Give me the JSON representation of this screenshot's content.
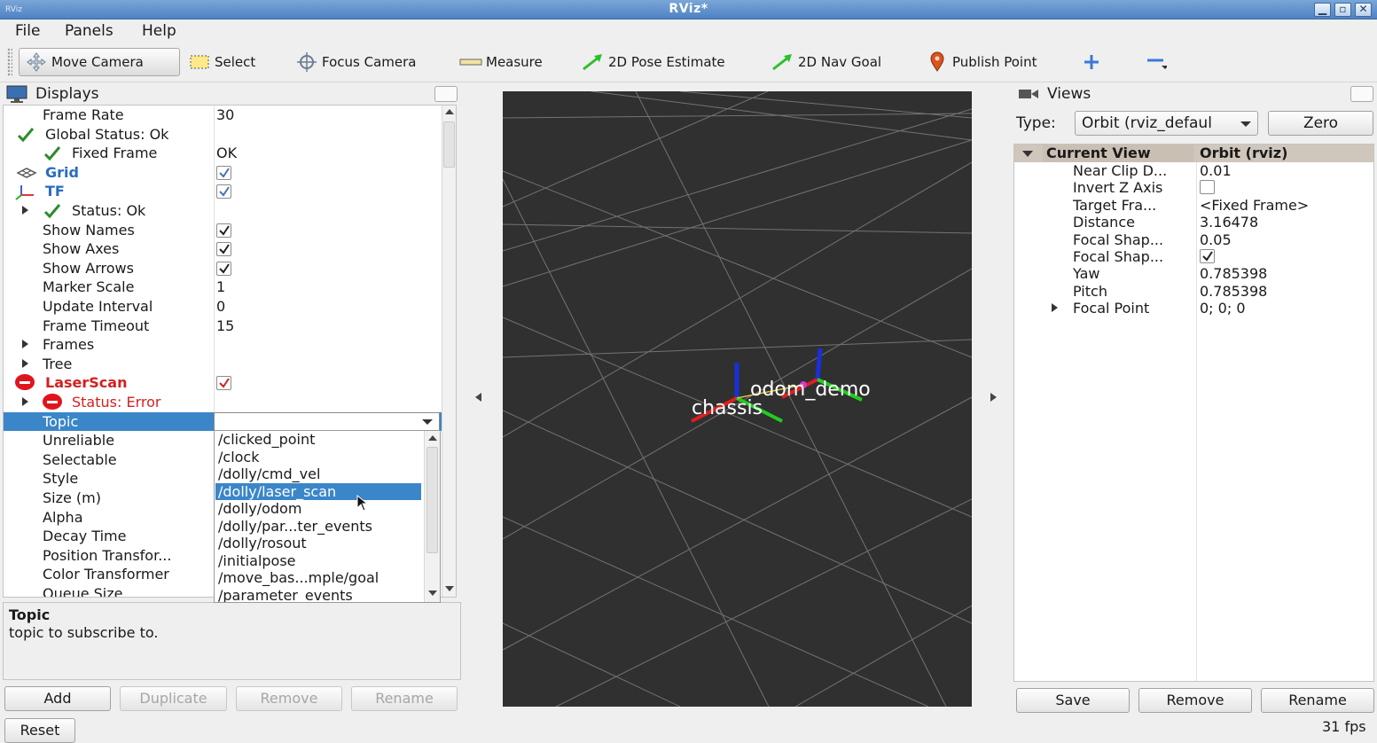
{
  "window": {
    "title": "RViz*",
    "app_icon": "RViz"
  },
  "menu": [
    "File",
    "Panels",
    "Help"
  ],
  "toolbar": [
    {
      "label": "Move Camera",
      "icon": "move-camera-icon",
      "active": true
    },
    {
      "label": "Select",
      "icon": "select-icon"
    },
    {
      "label": "Focus Camera",
      "icon": "focus-camera-icon"
    },
    {
      "label": "Measure",
      "icon": "measure-icon"
    },
    {
      "label": "2D Pose Estimate",
      "icon": "pose-estimate-arrow-icon"
    },
    {
      "label": "2D Nav Goal",
      "icon": "nav-goal-arrow-icon"
    },
    {
      "label": "Publish Point",
      "icon": "publish-point-pin-icon"
    }
  ],
  "displays": {
    "title": "Displays",
    "rows": [
      {
        "name": "Frame Rate",
        "value": "30"
      },
      {
        "name": "Global Status: Ok"
      },
      {
        "name": "Fixed Frame",
        "value": "OK"
      },
      {
        "name": "Grid"
      },
      {
        "name": "TF"
      },
      {
        "name": "Status: Ok"
      },
      {
        "name": "Show Names"
      },
      {
        "name": "Show Axes"
      },
      {
        "name": "Show Arrows"
      },
      {
        "name": "Marker Scale",
        "value": "1"
      },
      {
        "name": "Update Interval",
        "value": "0"
      },
      {
        "name": "Frame Timeout",
        "value": "15"
      },
      {
        "name": "Frames"
      },
      {
        "name": "Tree"
      },
      {
        "name": "LaserScan"
      },
      {
        "name": "Status: Error"
      },
      {
        "name": "Topic",
        "value": ""
      },
      {
        "name": "Unreliable"
      },
      {
        "name": "Selectable"
      },
      {
        "name": "Style"
      },
      {
        "name": "Size (m)"
      },
      {
        "name": "Alpha"
      },
      {
        "name": "Decay Time"
      },
      {
        "name": "Position Transfor..."
      },
      {
        "name": "Color Transformer"
      },
      {
        "name": "Queue Size"
      }
    ],
    "topic_options": [
      "/clicked_point",
      "/clock",
      "/dolly/cmd_vel",
      "/dolly/laser_scan",
      "/dolly/odom",
      "/dolly/par...ter_events",
      "/dolly/rosout",
      "/initialpose",
      "/move_bas...mple/goal",
      "/parameter_events"
    ],
    "selected_option": "/dolly/laser_scan",
    "description_title": "Topic",
    "description_text": "topic to subscribe to.",
    "buttons": {
      "add": "Add",
      "duplicate": "Duplicate",
      "remove": "Remove",
      "rename": "Rename",
      "reset": "Reset"
    }
  },
  "viewport": {
    "labels": {
      "chassis": "chassis",
      "odom": "odom_demo"
    }
  },
  "views": {
    "title": "Views",
    "type_label": "Type:",
    "type_value": "Orbit (rviz_defaul",
    "zero_button": "Zero",
    "header": {
      "name": "Current View",
      "value": "Orbit (rviz)"
    },
    "rows": [
      {
        "name": "Near Clip D...",
        "value": "0.01"
      },
      {
        "name": "Invert Z Axis",
        "value": ""
      },
      {
        "name": "Target Fra...",
        "value": "<Fixed Frame>"
      },
      {
        "name": "Distance",
        "value": "3.16478"
      },
      {
        "name": "Focal Shap...",
        "value": "0.05"
      },
      {
        "name": "Focal Shap...",
        "value": ""
      },
      {
        "name": "Yaw",
        "value": "0.785398"
      },
      {
        "name": "Pitch",
        "value": "0.785398"
      },
      {
        "name": "Focal Point",
        "value": "0; 0; 0"
      }
    ],
    "buttons": {
      "save": "Save",
      "remove": "Remove",
      "rename": "Rename"
    }
  },
  "status": {
    "fps": "31 fps"
  },
  "colors": {
    "selection": "#3a86c9",
    "error": "#e0141d",
    "link_blue": "#2a6bc2",
    "ok_green": "#2c8c2c",
    "viewport_bg": "#303030"
  }
}
